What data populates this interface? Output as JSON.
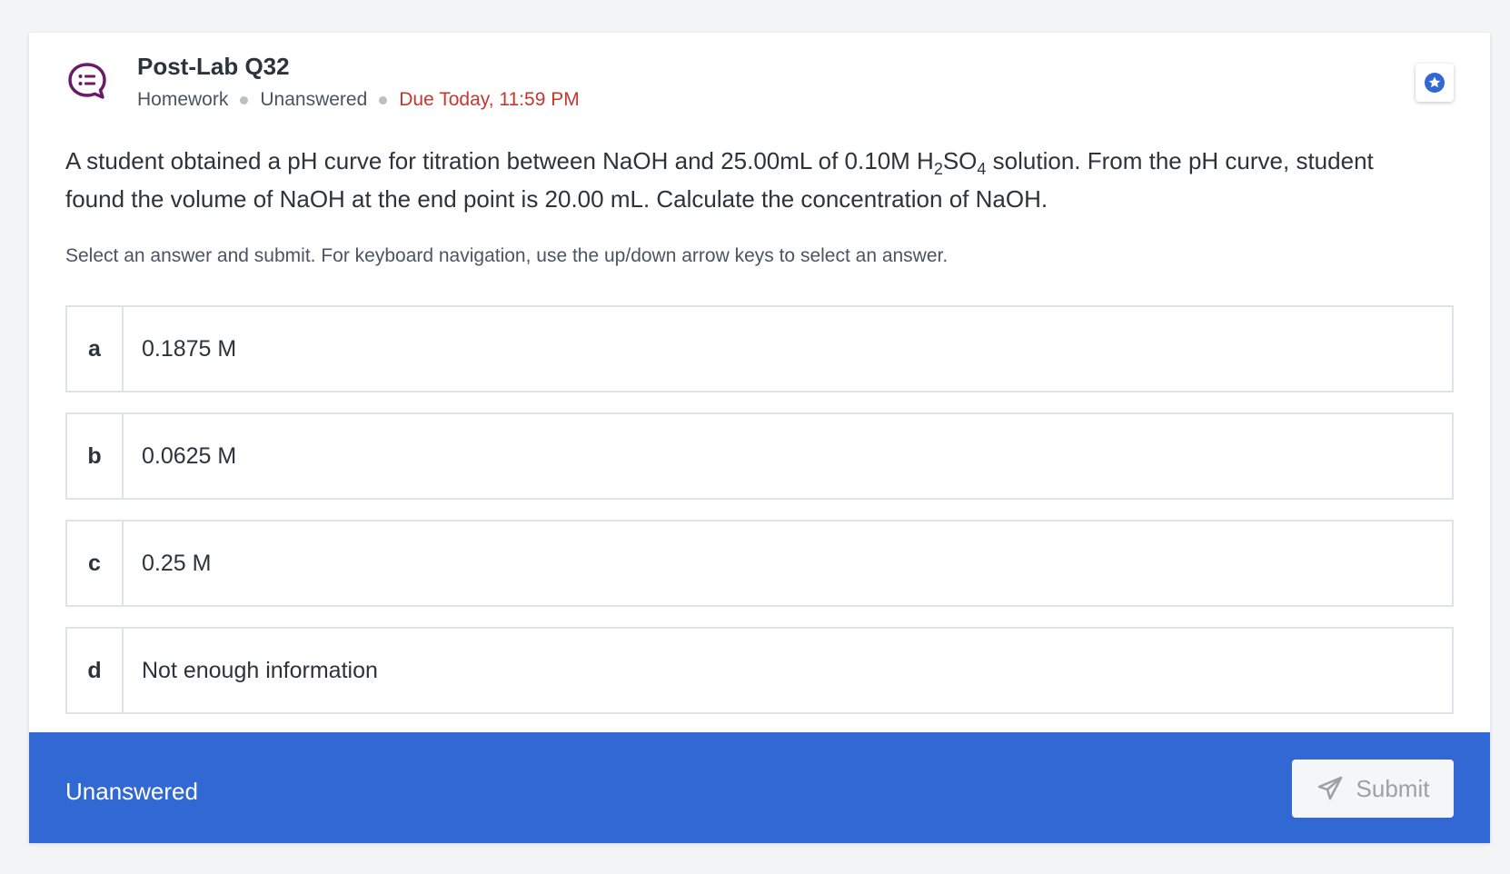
{
  "header": {
    "icon": "question-bubble-icon",
    "title": "Post-Lab Q32",
    "type": "Homework",
    "status": "Unanswered",
    "due": "Due Today, 11:59 PM",
    "bookmark_icon": "star-icon"
  },
  "question": {
    "text_part1": "A student obtained a pH curve for titration between NaOH and 25.00mL of 0.10M H",
    "sub1": "2",
    "text_part2": "SO",
    "sub2": "4",
    "text_part3": " solution. From the pH curve, student found the volume of NaOH at the end point is 20.00 mL. Calculate the concentration of NaOH."
  },
  "instructions": "Select an answer and submit. For keyboard navigation, use the up/down arrow keys to select an answer.",
  "options": [
    {
      "letter": "a",
      "text": "0.1875 M"
    },
    {
      "letter": "b",
      "text": "0.0625 M"
    },
    {
      "letter": "c",
      "text": "0.25 M"
    },
    {
      "letter": "d",
      "text": "Not enough information"
    }
  ],
  "footer": {
    "status": "Unanswered",
    "submit_label": "Submit",
    "submit_icon": "paper-plane-icon"
  },
  "colors": {
    "accent": "#3168d3",
    "due": "#c8372d",
    "icon_purple": "#6b1a6b"
  }
}
